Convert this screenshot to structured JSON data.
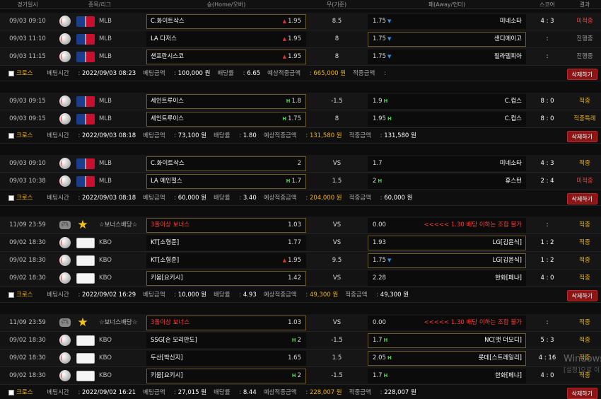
{
  "header": {
    "time": "경기일시",
    "league": "종목/리그",
    "home": "승(Home/오버)",
    "mid": "무(기준)",
    "away": "패(Away/언더)",
    "score": "스코어",
    "result": "결과"
  },
  "summary_labels": {
    "cross": "크로스",
    "bet_time": "베팅시간",
    "bet_amount": "베팅금액",
    "odds": "배당률",
    "expected": "예상적중금액",
    "hit": "적중금액",
    "delete": "삭제하기"
  },
  "groups": [
    {
      "rows": [
        {
          "time": "09/03 09:10",
          "league": "MLB",
          "home": "C.화이트삭스",
          "home_odds": "1.95",
          "home_mark": "up",
          "mid": "8.5",
          "away_odds": "1.75",
          "away_mark": "down",
          "away": "미네소타",
          "score": "4 : 3",
          "result": "미적중",
          "result_color": "#ff3b3b",
          "home_sel": true,
          "away_sel": false
        },
        {
          "time": "09/03 11:10",
          "league": "MLB",
          "home": "LA 다저스",
          "home_odds": "1.95",
          "home_mark": "up",
          "mid": "8",
          "away_odds": "1.75",
          "away_mark": "down",
          "away": "샌디에이고",
          "score": ":",
          "result": "진행중",
          "result_color": "#9a9a9a",
          "home_sel": false,
          "away_sel": true
        },
        {
          "time": "09/03 11:15",
          "league": "MLB",
          "home": "샌프란시스코",
          "home_odds": "1.95",
          "home_mark": "up",
          "mid": "8",
          "away_odds": "1.75",
          "away_mark": "down",
          "away": "필라델피아",
          "score": ":",
          "result": "진행중",
          "result_color": "#9a9a9a",
          "home_sel": true,
          "away_sel": false
        }
      ],
      "summary": {
        "bet_time": "2022/09/03 08:23",
        "bet_amount": "100,000 원",
        "odds": "6.65",
        "expected": "665,000 원",
        "hit": ""
      }
    },
    {
      "rows": [
        {
          "time": "09/03 09:15",
          "league": "MLB",
          "home": "세인트루이스",
          "home_odds": "1.8",
          "home_mark": "h",
          "mid": "-1.5",
          "away_odds": "1.9",
          "away_mark": "h",
          "away": "C.컵스",
          "score": "8 : 0",
          "result": "적중",
          "result_color": "#f0b400",
          "home_sel": true,
          "away_sel": false
        },
        {
          "time": "09/03 09:15",
          "league": "MLB",
          "home": "세인트루이스",
          "home_odds": "1.75",
          "home_mark": "h",
          "mid": "8",
          "away_odds": "1.95",
          "away_mark": "h",
          "away": "C.컵스",
          "score": "8 : 0",
          "result": "적중특례",
          "result_color": "#f0b400",
          "home_sel": true,
          "away_sel": false
        }
      ],
      "summary": {
        "bet_time": "2022/09/03 08:18",
        "bet_amount": "73,100 원",
        "odds": "1.80",
        "expected": "131,580 원",
        "hit": "131,580 원"
      }
    },
    {
      "rows": [
        {
          "time": "09/03 09:10",
          "league": "MLB",
          "home": "C.화이트삭스",
          "home_odds": "2",
          "home_mark": "",
          "mid": "VS",
          "away_odds": "1.7",
          "away_mark": "",
          "away": "미네소타",
          "score": "4 : 3",
          "result": "적중",
          "result_color": "#f0b400",
          "home_sel": true,
          "away_sel": false
        },
        {
          "time": "09/03 10:38",
          "league": "MLB",
          "home": "LA 에인절스",
          "home_odds": "1.7",
          "home_mark": "h",
          "mid": "1.5",
          "away_odds": "2",
          "away_mark": "h",
          "away": "휴스턴",
          "score": "2 : 4",
          "result": "미적중",
          "result_color": "#ff3b3b",
          "home_sel": true,
          "away_sel": false
        }
      ],
      "summary": {
        "bet_time": "2022/09/03 08:18",
        "bet_amount": "60,000 원",
        "odds": "3.40",
        "expected": "204,000 원",
        "hit": "60,000 원"
      }
    },
    {
      "rows": [
        {
          "time": "11/09 23:59",
          "league": "☆보너스배당☆",
          "bonus": true,
          "home": "3폴이상 보너스",
          "home_odds": "1.03",
          "home_mark": "",
          "mid": "VS",
          "away_odds": "0.00",
          "away_mark": "",
          "away": "<<<<< 1.30 배당 이하는 조합 불가",
          "away_warn": true,
          "score": ":",
          "result": "적중",
          "result_color": "#f0b400",
          "home_sel": true,
          "away_sel": false
        },
        {
          "time": "09/02 18:30",
          "league": "KBO",
          "home": "KT[소형준]",
          "home_odds": "1.77",
          "home_mark": "",
          "mid": "VS",
          "away_odds": "1.93",
          "away_mark": "",
          "away": "LG[김윤식]",
          "score": "1 : 2",
          "result": "적중",
          "result_color": "#f0b400",
          "home_sel": false,
          "away_sel": true
        },
        {
          "time": "09/02 18:30",
          "league": "KBO",
          "home": "KT[소형준]",
          "home_odds": "1.95",
          "home_mark": "up",
          "mid": "9.5",
          "away_odds": "1.75",
          "away_mark": "down",
          "away": "LG[김윤식]",
          "score": "1 : 2",
          "result": "적중",
          "result_color": "#f0b400",
          "home_sel": false,
          "away_sel": true
        },
        {
          "time": "09/02 18:30",
          "league": "KBO",
          "home": "키움[요키시]",
          "home_odds": "1.42",
          "home_mark": "",
          "mid": "VS",
          "away_odds": "2.28",
          "away_mark": "",
          "away": "한화[페냐]",
          "score": "4 : 0",
          "result": "적중",
          "result_color": "#f0b400",
          "home_sel": true,
          "away_sel": false
        }
      ],
      "summary": {
        "bet_time": "2022/09/02 16:29",
        "bet_amount": "10,000 원",
        "odds": "4.93",
        "expected": "49,300 원",
        "hit": "49,300 원"
      }
    },
    {
      "rows": [
        {
          "time": "11/09 23:59",
          "league": "☆보너스배당☆",
          "bonus": true,
          "home": "3폴이상 보너스",
          "home_odds": "1.03",
          "home_mark": "",
          "mid": "VS",
          "away_odds": "0.00",
          "away_mark": "",
          "away": "<<<<< 1.30 배당 이하는 조합 불가",
          "away_warn": true,
          "score": ":",
          "result": "적중",
          "result_color": "#f0b400",
          "home_sel": true,
          "away_sel": false
        },
        {
          "time": "09/02 18:30",
          "league": "KBO",
          "home": "SSG[숀 모리만도]",
          "home_odds": "2",
          "home_mark": "h",
          "mid": "-1.5",
          "away_odds": "1.7",
          "away_mark": "h",
          "away": "NC[맷 더모디]",
          "score": "5 : 3",
          "result": "적중",
          "result_color": "#f0b400",
          "home_sel": false,
          "away_sel": true
        },
        {
          "time": "09/02 18:30",
          "league": "KBO",
          "home": "두산[박신지]",
          "home_odds": "1.65",
          "home_mark": "",
          "mid": "1.5",
          "away_odds": "2.05",
          "away_mark": "h",
          "away": "롯데[스트레일리]",
          "score": "4 : 16",
          "result": "적중",
          "result_color": "#f0b400",
          "home_sel": false,
          "away_sel": true
        },
        {
          "time": "09/02 18:30",
          "league": "KBO",
          "home": "키움[요키시]",
          "home_odds": "2",
          "home_mark": "h",
          "mid": "-1.5",
          "away_odds": "1.7",
          "away_mark": "h",
          "away": "한화[페냐]",
          "score": "4 : 0",
          "result": "적중",
          "result_color": "#f0b400",
          "home_sel": true,
          "away_sel": false
        }
      ],
      "summary": {
        "bet_time": "2022/09/02 16:21",
        "bet_amount": "27,015 원",
        "odds": "8.44",
        "expected": "228,007 원",
        "hit": "228,007 원"
      }
    }
  ],
  "watermark": {
    "line1": "Windows",
    "line2": "[설정]으로 이"
  }
}
